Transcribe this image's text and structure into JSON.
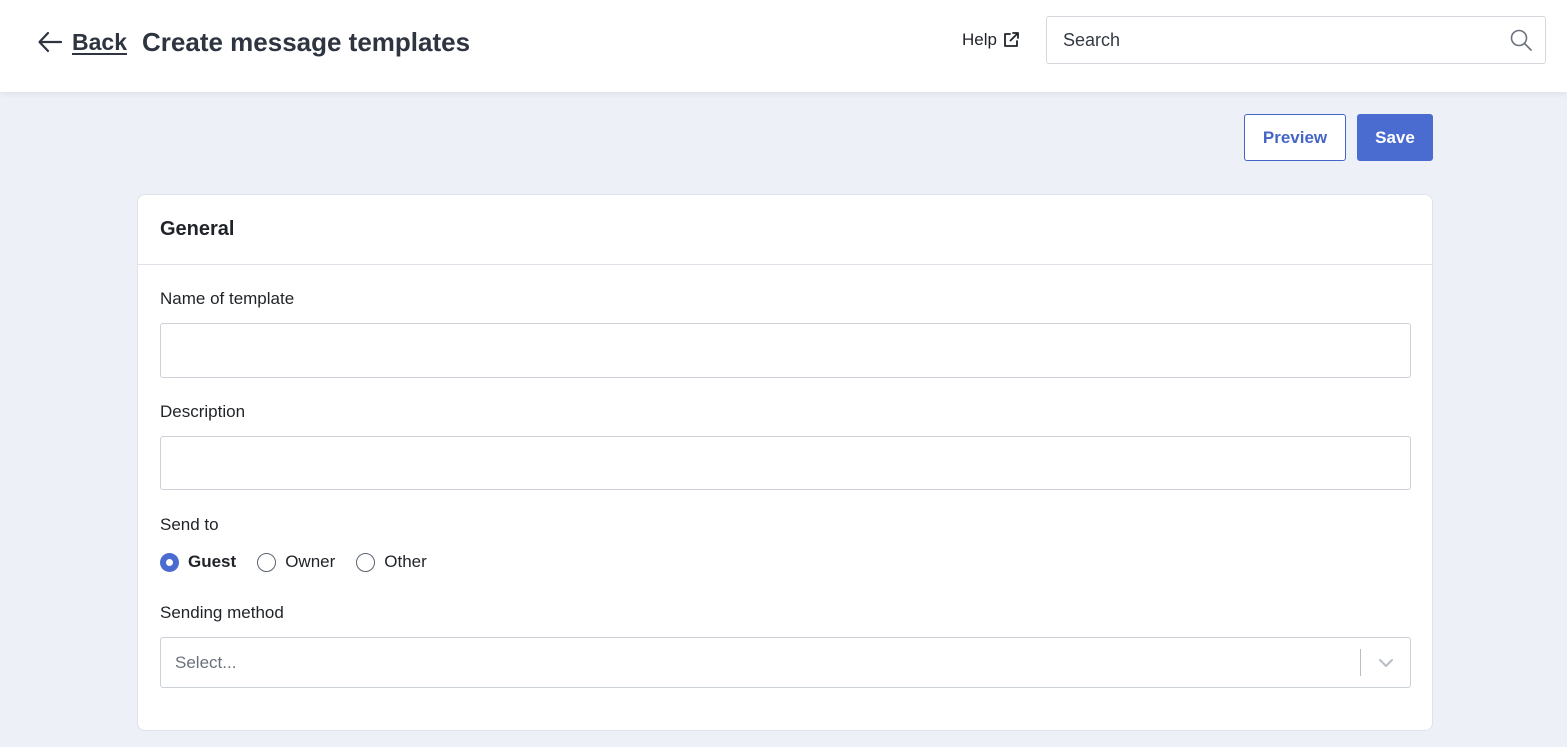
{
  "header": {
    "back_label": "Back",
    "title": "Create message templates",
    "help_label": "Help",
    "search_placeholder": "Search"
  },
  "actions": {
    "preview_label": "Preview",
    "save_label": "Save"
  },
  "form": {
    "section_title": "General",
    "template_name": {
      "label": "Name of template",
      "value": ""
    },
    "description": {
      "label": "Description",
      "value": ""
    },
    "send_to": {
      "label": "Send to",
      "options": [
        "Guest",
        "Owner",
        "Other"
      ],
      "selected": "Guest"
    },
    "sending_method": {
      "label": "Sending method",
      "placeholder": "Select..."
    }
  },
  "colors": {
    "accent": "#4a6bd0",
    "page_background": "#edf0f7"
  },
  "icons": {
    "back": "arrow-left-icon",
    "help": "external-link-icon",
    "search": "search-icon",
    "dropdown": "chevron-down-icon"
  }
}
